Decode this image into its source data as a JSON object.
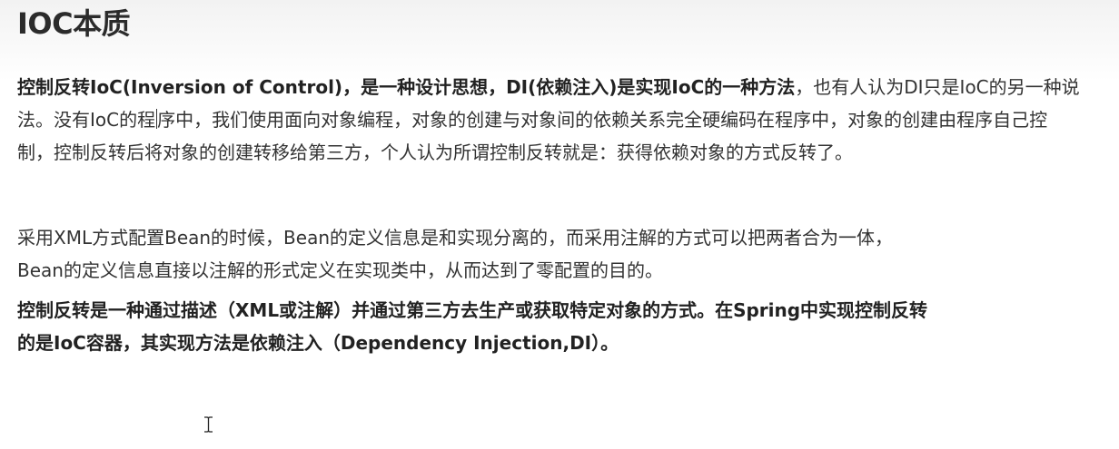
{
  "title": "IOC本质",
  "paragraph1": {
    "bold_lead": "控制反转IoC(Inversion of Control)，是一种设计思想，DI(依赖注入)是实现IoC的一种方法",
    "text_before_cursor": "，也有人认为DI只是IoC的另一种说法。没有IoC的程",
    "text_after_cursor": "序中，我们使用面向对象编程，对象的创建与对象间的依赖关系完全硬编码在程序中，对象的创建由程序自己控制，控制反转后将对象的创建转移给第三方，个人认为所谓控制反转就是：获得依赖对象的方式反转了。"
  },
  "paragraph2": {
    "line1": "采用XML方式配置Bean的时候，Bean的定义信息是和实现分离的，而采用注解的方式可以把两者合为一体，",
    "line2": "Bean的定义信息直接以注解的形式定义在实现类中，从而达到了零配置的目的。"
  },
  "paragraph3": {
    "line1": "控制反转是一种通过描述（XML或注解）并通过第三方去生产或获取特定对象的方式。在Spring中实现控制反转",
    "line2": "的是IoC容器，其实现方法是依赖注入（Dependency Injection,DI）。"
  },
  "icons": {
    "mouse_cursor": "ibeam-cursor-icon"
  }
}
